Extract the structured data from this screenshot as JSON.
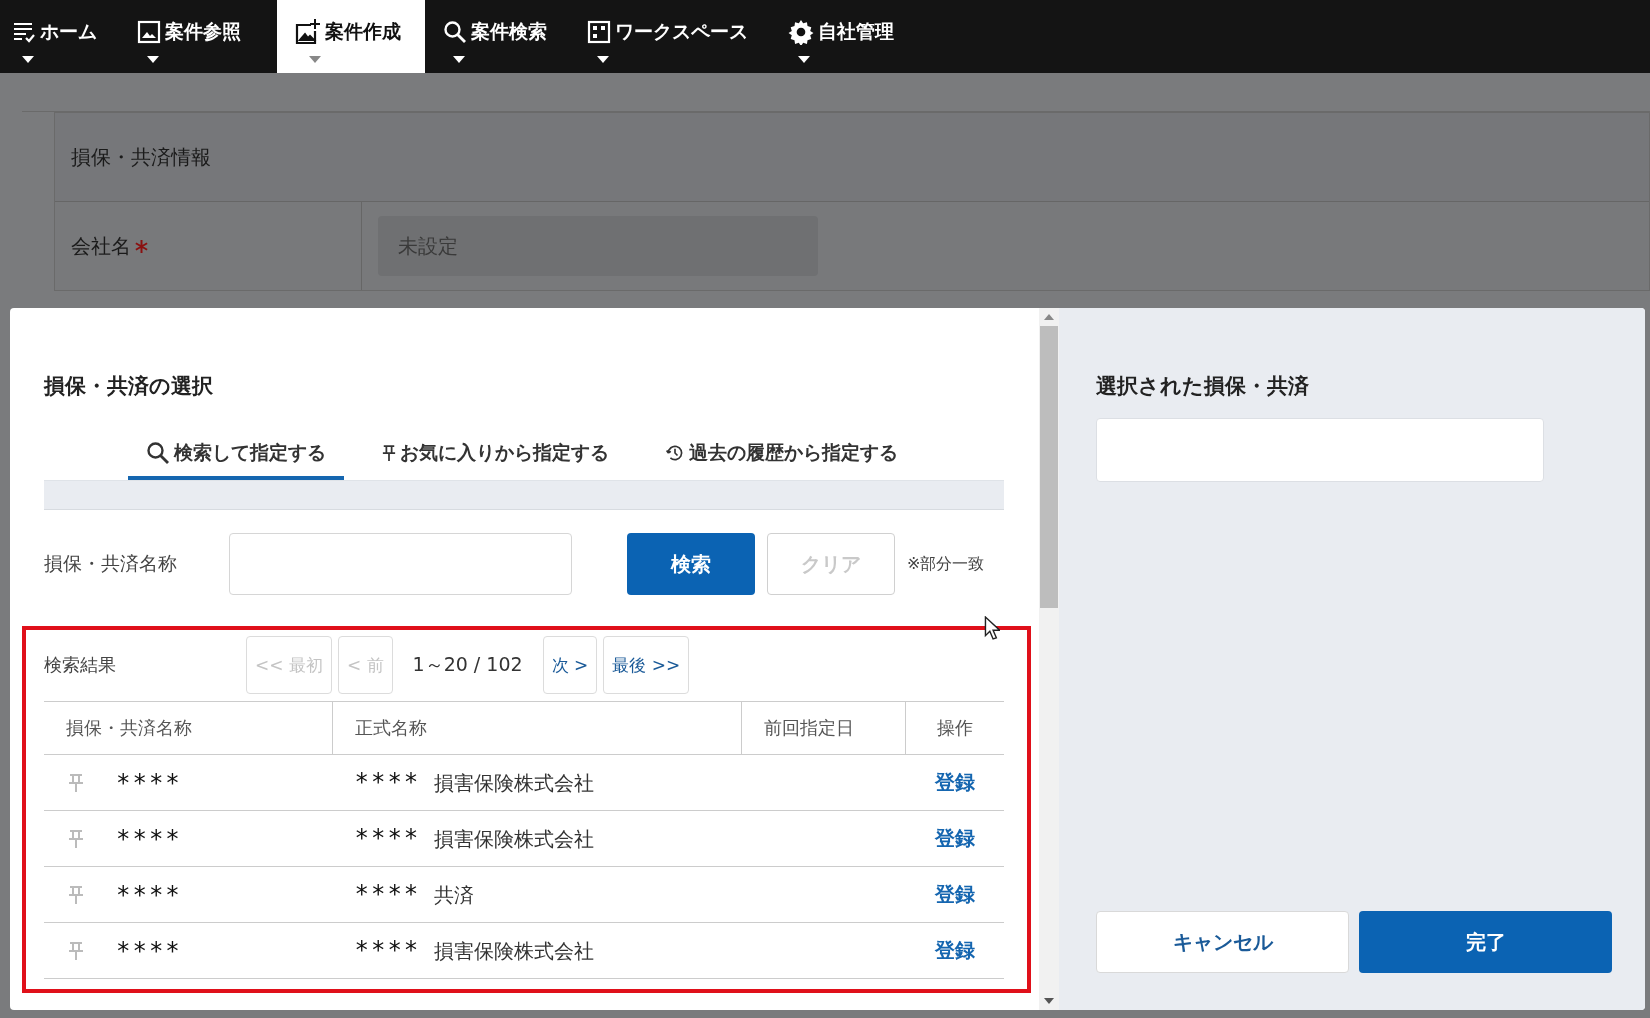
{
  "nav": [
    {
      "label": "ホーム",
      "selected": false
    },
    {
      "label": "案件参照",
      "selected": false
    },
    {
      "label": "案件作成",
      "selected": true
    },
    {
      "label": "案件検索",
      "selected": false
    },
    {
      "label": "ワークスペース",
      "selected": false
    },
    {
      "label": "自社管理",
      "selected": false
    }
  ],
  "background_form": {
    "section_title": "損保・共済情報",
    "fields": [
      {
        "label": "会社名",
        "required": true,
        "placeholder": "未設定"
      }
    ]
  },
  "dialog": {
    "title": "損保・共済の選択",
    "tabs": [
      {
        "label": "検索して指定する",
        "selected": true
      },
      {
        "label": "お気に入りから指定する",
        "selected": false
      },
      {
        "label": "過去の履歴から指定する",
        "selected": false
      }
    ],
    "search": {
      "label": "損保・共済名称",
      "search_button": "検索",
      "clear_button": "クリア",
      "clear_disabled": true,
      "note": "※部分一致"
    },
    "results": {
      "label": "検索結果",
      "pager": [
        {
          "kind": "button",
          "label": "<< 最初",
          "disabled": true
        },
        {
          "kind": "button",
          "label": "< 前",
          "disabled": true
        },
        {
          "kind": "text",
          "label": "1～20 / 102"
        },
        {
          "kind": "button",
          "label": "次 >",
          "disabled": false
        },
        {
          "kind": "button",
          "label": "最後 >>",
          "disabled": false
        }
      ],
      "columns": [
        "損保・共済名称",
        "正式名称",
        "前回指定日",
        "操作"
      ],
      "rows": [
        {
          "pinned": false,
          "name": "****",
          "formal_mask": "****",
          "formal_name": "損害保険株式会社",
          "action": "登録"
        },
        {
          "pinned": false,
          "name": "****",
          "formal_mask": "****",
          "formal_name": "損害保険株式会社",
          "action": "登録"
        },
        {
          "pinned": false,
          "name": "****",
          "formal_mask": "****",
          "formal_name": "共済",
          "action": "登録"
        },
        {
          "pinned": false,
          "name": "****",
          "formal_mask": "****",
          "formal_name": "損害保険株式会社",
          "action": "登録"
        }
      ]
    },
    "selected_panel": {
      "title": "選択された損保・共済",
      "cancel_button": "キャンセル",
      "done_button": "完了"
    }
  }
}
